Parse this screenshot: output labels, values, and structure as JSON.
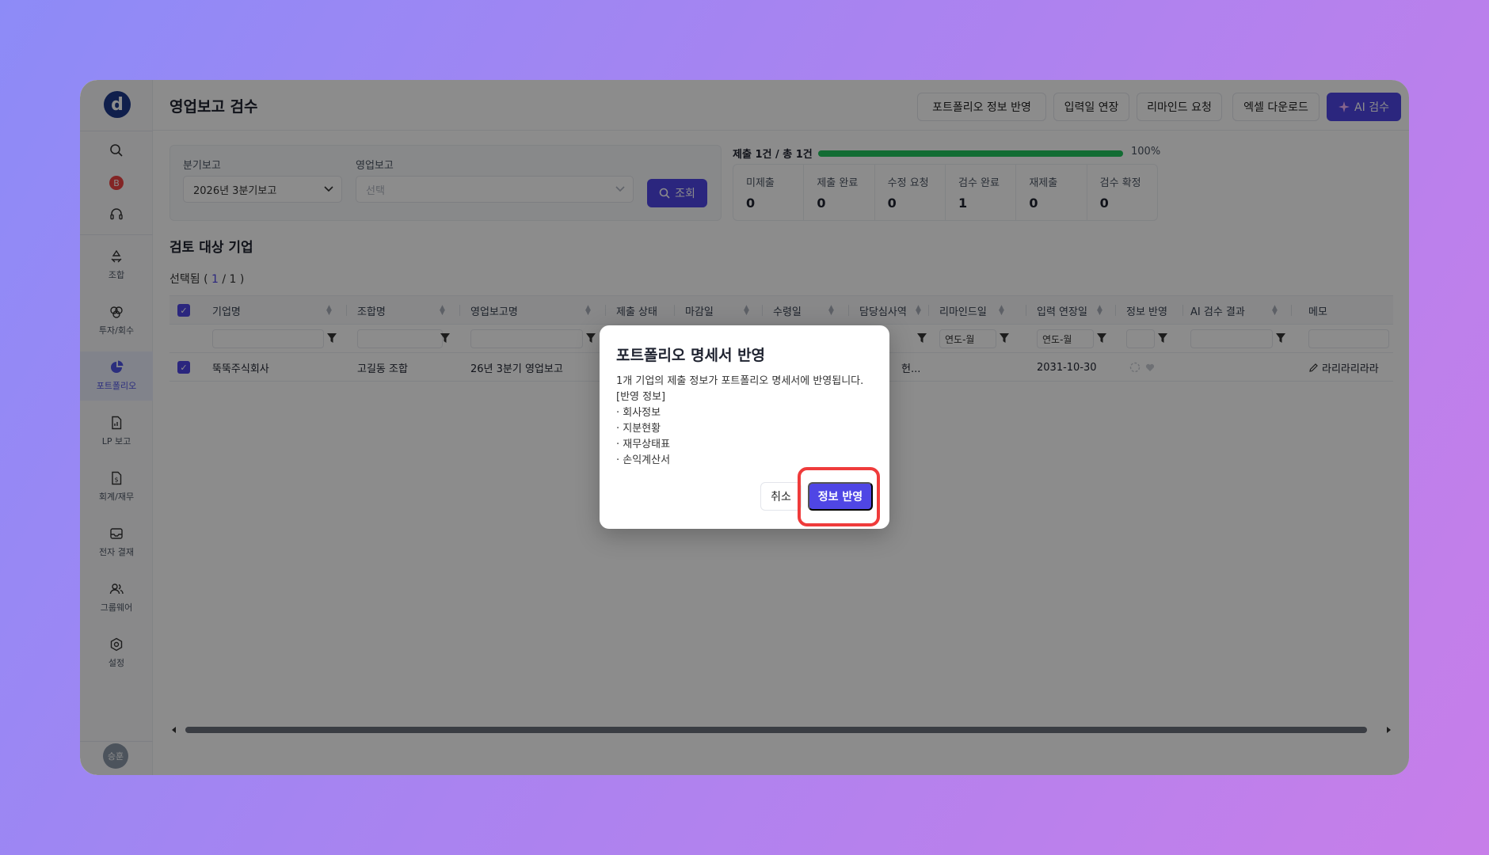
{
  "sidebar": {
    "logo": "d",
    "badge": "B",
    "nav": [
      {
        "label": "조합",
        "icon": "recycle-icon"
      },
      {
        "label": "투자/회수",
        "icon": "investment-icon"
      },
      {
        "label": "포트폴리오",
        "icon": "pie-chart-icon",
        "active": true
      },
      {
        "label": "LP 보고",
        "icon": "document-chart-icon"
      },
      {
        "label": "회계/재무",
        "icon": "dollar-document-icon"
      },
      {
        "label": "전자 결재",
        "icon": "inbox-icon"
      },
      {
        "label": "그룹웨어",
        "icon": "users-icon"
      },
      {
        "label": "설정",
        "icon": "gear-icon"
      }
    ],
    "avatar": "승훈"
  },
  "header": {
    "title": "영업보고 검수",
    "buttons": {
      "portfolio_apply": "포트폴리오 정보 반영",
      "extend_input": "입력일 연장",
      "remind": "리마인드 요청",
      "excel": "엑셀 다운로드",
      "ai_review": "AI 검수"
    }
  },
  "filters": {
    "quarter_label": "분기보고",
    "quarter_value": "2026년 3분기보고",
    "report_label": "영업보고",
    "report_placeholder": "선택",
    "search_button": "조회"
  },
  "progress": {
    "label": "제출 1건 / 총 1건",
    "percent_text": "100%",
    "percent": 100,
    "stats": [
      {
        "label": "미제출",
        "value": "0"
      },
      {
        "label": "제출 완료",
        "value": "0"
      },
      {
        "label": "수정 요청",
        "value": "0"
      },
      {
        "label": "검수 완료",
        "value": "1"
      },
      {
        "label": "재제출",
        "value": "0"
      },
      {
        "label": "검수 확정",
        "value": "0"
      }
    ]
  },
  "section": {
    "title": "검토 대상 기업",
    "selected_prefix": "선택됨 ( ",
    "selected_num": "1",
    "selected_suffix": " / 1 )"
  },
  "table": {
    "headers": {
      "company": "기업명",
      "fund": "조합명",
      "report": "영업보고명",
      "status": "제출 상태",
      "deadline": "마감일",
      "received": "수령일",
      "manager": "담당심사역",
      "remind": "리마인드일",
      "extend": "입력 연장일",
      "info": "정보 반영",
      "ai": "AI 검수 결과",
      "memo": "메모"
    },
    "filter_date_placeholder": "연도-월",
    "row": {
      "company": "뚝뚝주식회사",
      "fund": "고길동 조합",
      "report": "26년 3분기 영업보고",
      "manager": "헌...",
      "extend": "2031-10-30",
      "memo": "라리라리라라"
    }
  },
  "modal": {
    "title": "포트폴리오 명세서 반영",
    "line1": "1개 기업의 제출 정보가 포트폴리오 명세서에 반영됩니다.",
    "line2": "[반영 정보]",
    "items": [
      "· 회사정보",
      "· 지분현황",
      "· 재무상태표",
      "· 손익계산서"
    ],
    "cancel": "취소",
    "confirm": "정보 반영"
  }
}
